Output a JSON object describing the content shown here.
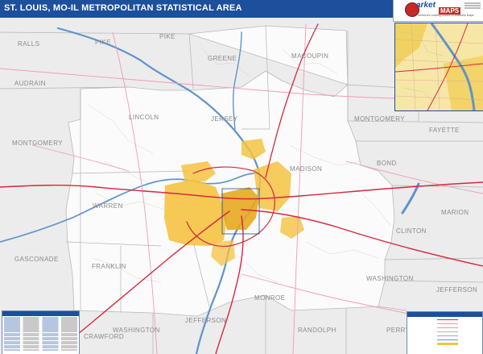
{
  "header": {
    "title": "ST. LOUIS, MO-IL METROPOLITAN STATISTICAL AREA"
  },
  "brand": {
    "market": "arket",
    "maps": "MAPS",
    "tagline": "America's Leading Source of Business Maps"
  },
  "counties": [
    {
      "name": "RALLS"
    },
    {
      "name": "PIKE"
    },
    {
      "name": "PIKE"
    },
    {
      "name": "AUDRAIN"
    },
    {
      "name": "GREENE"
    },
    {
      "name": "MACOUPIN"
    },
    {
      "name": "MONTGOMERY"
    },
    {
      "name": "LINCOLN"
    },
    {
      "name": "JERSEY"
    },
    {
      "name": "MONTGOMERY"
    },
    {
      "name": "FAYETTE"
    },
    {
      "name": "BOND"
    },
    {
      "name": "WARREN"
    },
    {
      "name": "MADISON"
    },
    {
      "name": "MARION"
    },
    {
      "name": "CLINTON"
    },
    {
      "name": "GASCONADE"
    },
    {
      "name": "FRANKLIN"
    },
    {
      "name": "WASHINGTON"
    },
    {
      "name": "JEFFERSON"
    },
    {
      "name": "MONROE"
    },
    {
      "name": "JEFFERSON"
    },
    {
      "name": "RANDOLPH"
    },
    {
      "name": "WASHINGTON"
    },
    {
      "name": "PERRY"
    },
    {
      "name": "CRAWFORD"
    }
  ],
  "colors": {
    "title_bar": "#1c4f9c",
    "land_outside": "#ececec",
    "land_msa": "#fbfbfb",
    "urban": "#f5c342",
    "urban_dense": "#e7a91f",
    "river": "#5f93cc",
    "interstate": "#d7263d",
    "highway": "#f29bb0",
    "boundary": "#a9a9a9"
  }
}
